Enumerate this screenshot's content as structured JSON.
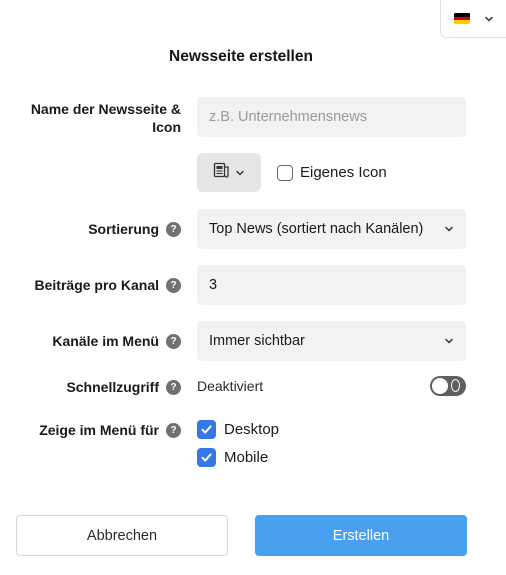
{
  "language_selector": {
    "flag_colors": [
      "#000000",
      "#dd0000",
      "#ffce00"
    ],
    "icon": "chevron-down-icon"
  },
  "dialog": {
    "title": "Newsseite erstellen"
  },
  "name_field": {
    "label": "Name der Newsseite & Icon",
    "placeholder": "z.B. Unternehmensnews",
    "value": ""
  },
  "icon_picker": {
    "icon": "newspaper-icon",
    "custom_icon_label": "Eigenes Icon",
    "custom_icon_checked": false
  },
  "sorting": {
    "label": "Sortierung",
    "value": "Top News (sortiert nach Kanälen)"
  },
  "posts_per_channel": {
    "label": "Beiträge pro Kanal",
    "value": "3"
  },
  "channels_in_menu": {
    "label": "Kanäle im Menü",
    "value": "Immer sichtbar"
  },
  "quick_access": {
    "label": "Schnellzugriff",
    "status": "Deaktiviert",
    "enabled": false
  },
  "show_in_menu": {
    "label": "Zeige im Menü für",
    "options": [
      {
        "label": "Desktop",
        "checked": true
      },
      {
        "label": "Mobile",
        "checked": true
      }
    ]
  },
  "buttons": {
    "cancel": "Abbrechen",
    "create": "Erstellen"
  },
  "colors": {
    "primary": "#4aa0f0",
    "checkbox": "#3478e5",
    "field_bg": "#f2f2f2"
  }
}
